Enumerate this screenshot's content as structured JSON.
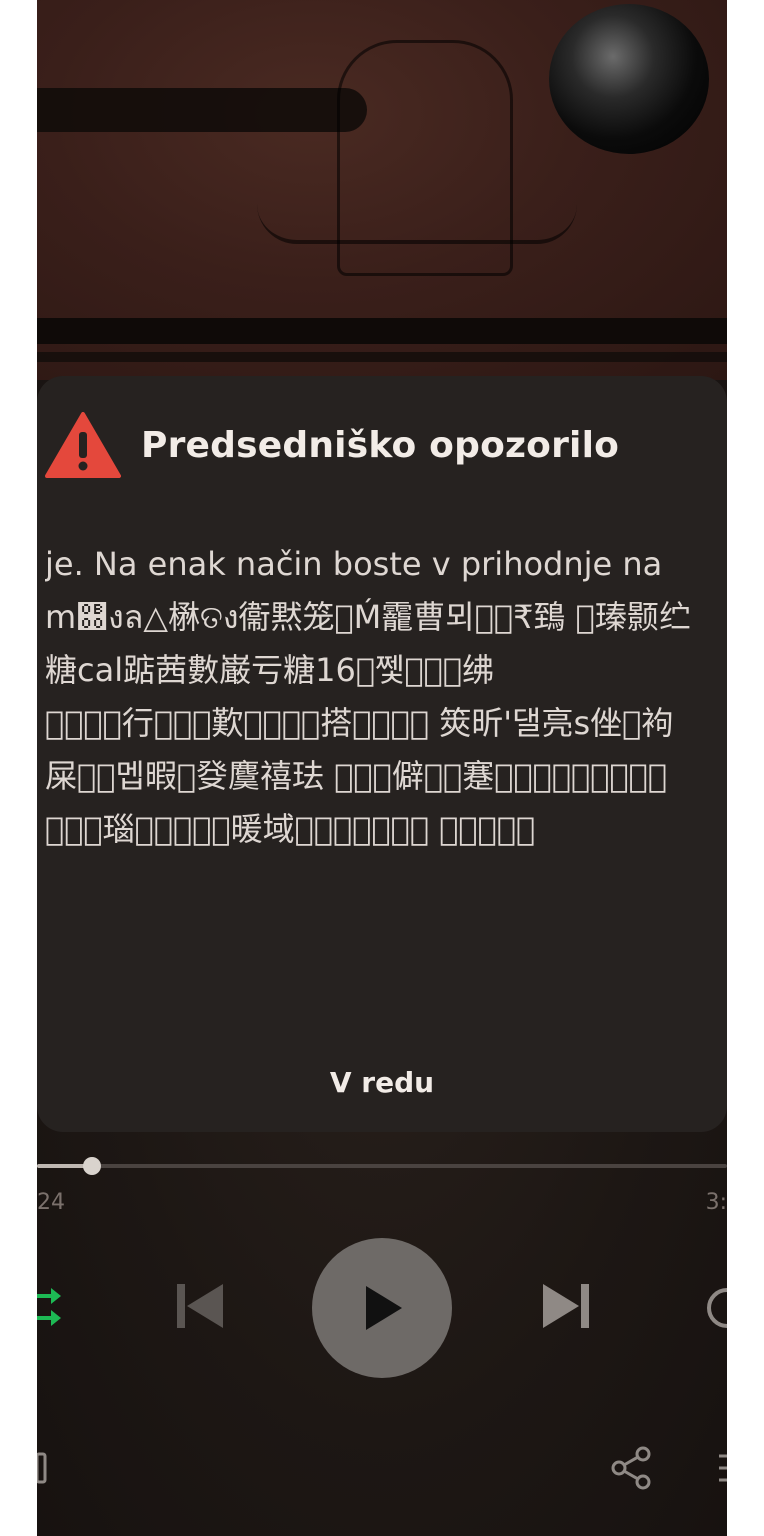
{
  "dialog": {
    "title": "Predsedniško opozorilo",
    "body_lines": [
      "je. Na enak način boste v prihodnje na m\u0000ញប△楙ତง衞黙笼\u0000Ḿ靇曹ᄀㅇぷ\u0000☆",
      "\u0000瑧颢纻糖cal踮茜數巌下糖16\u0000쩿\u0000\u0000ဂ绋",
      "\u0000\u0000\u0000行\u0000\u0000\u0000歎\u0000\u0000\u0000\u0000\u0000\u0000搭\u0000\u0000\u0000\u0000",
      "筴昕'댈亮s侳\u0000袧屎\u0000\u0000멥暇\u0000癹麌禧珐",
      "\u0000\u0000\u0000僻\u0000\u0000蹇\u0000\u0000\u0000\u0000\u0000\u0000\u0000\u0000\u0000\u0000",
      "\u0000\u0000\u0000瑙\u0000\u0000\u0000\u0000\u0000\u0000\u0000\u0000\u0000\u0000\u0000",
      "\u0000\u0000\u0000\u0000\u0000\u0000"
    ],
    "body_text": "je. Na enak način boste v prihodnje na m଀งล△楙ତง衞黙笼\u0000Ḿ靇曹뫼\u0000\u0000₹鵄 \u0000瑧颢纻糖cal踮茜數巌亏糖16\u0000쩿\u0000\u0000\u0000绋 \u0000\u0000\u0000\u0000行\u0000\u0000\u0000歎\u0000\u0000\u0000\u0000搭\u0000\u0000\u0000\u0000 筴昕'댈亮s侳\u0000袧屎\u0000\u0000멥暇\u0000癹麌禧珐 \u0000\u0000\u0000僻\u0000\u0000蹇\u0000\u0000\u0000\u0000\u0000\u0000\u0000\u0000\u0000 \u0000\u0000\u0000瑙\u0000\u0000\u0000\u0000\u0000暖域\u0000\u0000\u0000\u0000\u0000\u0000\u0000 \u0000\u0000\u0000\u0000\u0000",
    "ok_label": "V redu"
  },
  "player": {
    "time_elapsed": "24",
    "time_total": "3:",
    "progress_fraction": 0.08
  },
  "colors": {
    "warning": "#e4483c",
    "shuffle_active": "#1db954"
  }
}
